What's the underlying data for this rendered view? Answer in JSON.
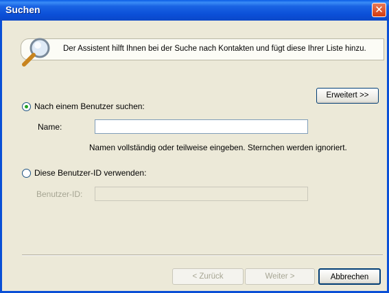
{
  "window": {
    "title": "Suchen",
    "close_glyph": "✕"
  },
  "banner": {
    "text": "Der Assistent hilft Ihnen bei der Suche nach Kontakten und fügt diese Ihrer Liste hinzu.",
    "icon": "magnifier-icon"
  },
  "advanced_button": {
    "label": "Erweitert >>"
  },
  "search_by_user": {
    "radio_label": "Nach einem Benutzer suchen:",
    "selected": true,
    "name_label": "Name:",
    "name_value": "",
    "hint": "Namen vollständig oder teilweise eingeben. Sternchen werden ignoriert."
  },
  "use_user_id": {
    "radio_label": "Diese Benutzer-ID verwenden:",
    "selected": false,
    "id_label": "Benutzer-ID:",
    "id_value": ""
  },
  "footer": {
    "back_label": "< Zurück",
    "next_label": "Weiter >",
    "cancel_label": "Abbrechen"
  },
  "colors": {
    "title_bar": "#0b4fd8",
    "dialog_bg": "#ece9d8",
    "close_button": "#d43a0e"
  }
}
